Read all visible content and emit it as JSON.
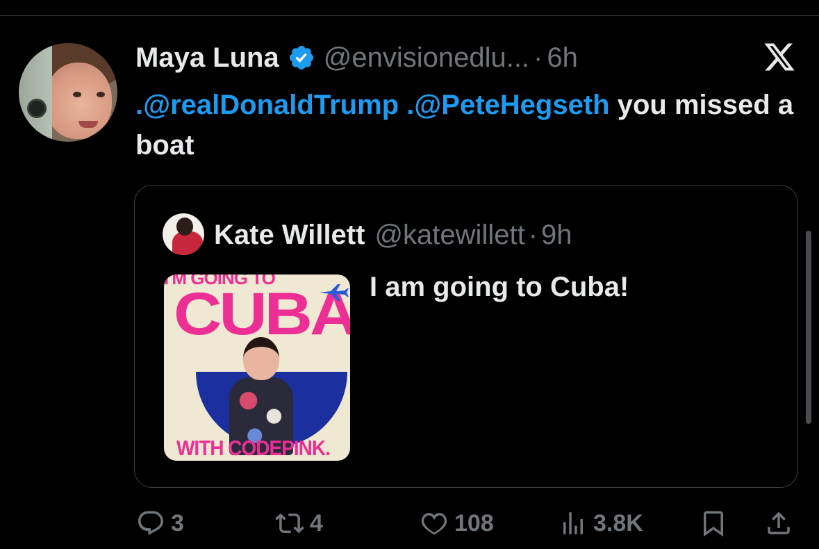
{
  "tweet": {
    "author_name": "Maya Luna",
    "author_handle": "@envisionedlu...",
    "separator": "·",
    "time": "6h",
    "verified_icon": "verified-badge-icon",
    "text_parts": [
      ".@realDonaldTrump",
      " ",
      ".@PeteHegseth",
      " you missed a boat"
    ]
  },
  "quoted_tweet": {
    "author_name": "Kate Willett",
    "author_handle": "@katewillett",
    "separator": "·",
    "time": "9h",
    "text": "I am going to Cuba!",
    "media": {
      "top_text": "I'M GOING TO",
      "main_text": "CUBA",
      "bottom_text": "WITH CODEPINK."
    }
  },
  "actions": {
    "reply_count": "3",
    "repost_count": "4",
    "like_count": "108",
    "views_count": "3.8K"
  },
  "colors": {
    "background": "#000000",
    "text": "#e7e9ea",
    "muted": "#71767b",
    "link": "#1d9bf0",
    "verified": "#1d9bf0",
    "media_pink": "#ec2f94",
    "media_blue": "#1b2f9e"
  },
  "icons": [
    "verified-badge-icon",
    "x-logo-icon",
    "reply-icon",
    "repost-icon",
    "like-icon",
    "views-icon",
    "bookmark-icon",
    "share-icon"
  ]
}
